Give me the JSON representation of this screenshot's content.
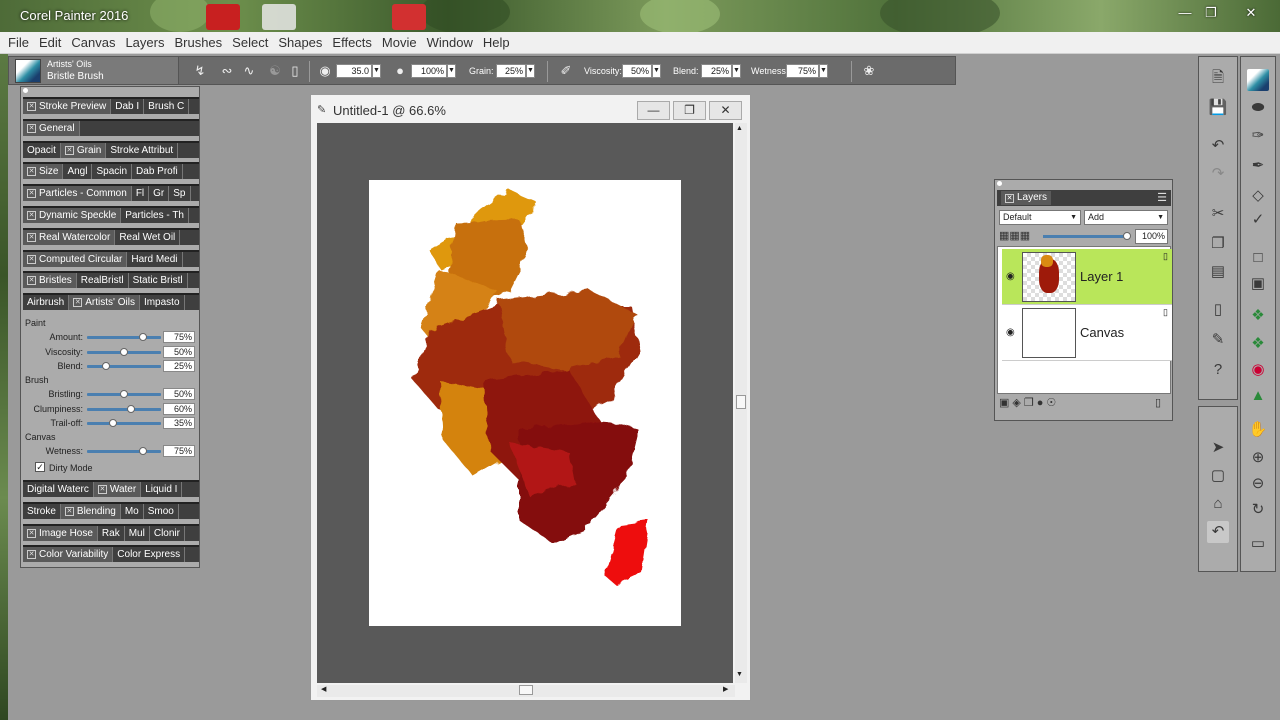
{
  "window": {
    "title": "Corel Painter 2016"
  },
  "menu": [
    "File",
    "Edit",
    "Canvas",
    "Layers",
    "Brushes",
    "Select",
    "Shapes",
    "Effects",
    "Movie",
    "Window",
    "Help"
  ],
  "property_bar": {
    "brush_category": "Artists' Oils",
    "brush_variant": "Bristle Brush",
    "size_value": "35.0",
    "opacity_value": "100%",
    "grain_label": "Grain:",
    "grain_value": "25%",
    "viscosity_label": "Viscosity:",
    "viscosity_value": "50%",
    "blend_label": "Blend:",
    "blend_value": "25%",
    "wetness_label": "Wetness:",
    "wetness_value": "75%"
  },
  "left_panel": {
    "tab_rows": [
      [
        "Stroke Preview",
        "Dab I",
        "Brush C"
      ],
      [
        "General"
      ],
      [
        "Opacit",
        "Grain",
        "Stroke Attribut"
      ],
      [
        "Size",
        "Angl",
        "Spacin",
        "Dab Profi"
      ],
      [
        "Particles - Common",
        "Fl",
        "Gr",
        "Sp"
      ],
      [
        "Dynamic Speckle",
        "Particles - Th"
      ],
      [
        "Real Watercolor",
        "Real Wet Oil"
      ],
      [
        "Computed Circular",
        "Hard Medi"
      ],
      [
        "Bristles",
        "RealBristl",
        "Static Bristl"
      ],
      [
        "Airbrush",
        "Artists' Oils",
        "Impasto"
      ]
    ],
    "tab_rows_bottom": [
      [
        "Digital Waterc",
        "Water",
        "Liquid I"
      ],
      [
        "Stroke",
        "Blending",
        "Mo",
        "Smoo"
      ],
      [
        "Image Hose",
        "Rak",
        "Mul",
        "Clonir"
      ],
      [
        "Color Variability",
        "Color Express"
      ]
    ],
    "artists_oils": {
      "paint_header": "Paint",
      "amount_label": "Amount:",
      "amount_value": "75%",
      "amount_pct": 75,
      "viscosity_label": "Viscosity:",
      "viscosity_value": "50%",
      "viscosity_pct": 50,
      "blend_label": "Blend:",
      "blend_value": "25%",
      "blend_pct": 25,
      "brush_header": "Brush",
      "bristling_label": "Bristling:",
      "bristling_value": "50%",
      "bristling_pct": 50,
      "clumpiness_label": "Clumpiness:",
      "clumpiness_value": "60%",
      "clumpiness_pct": 60,
      "trailoff_label": "Trail-off:",
      "trailoff_value": "35%",
      "trailoff_pct": 35,
      "canvas_header": "Canvas",
      "wetness_label": "Wetness:",
      "wetness_value": "75%",
      "wetness_pct": 75,
      "dirty_mode_label": "Dirty Mode",
      "dirty_mode_checked": true
    }
  },
  "document": {
    "title": "Untitled-1 @ 66.6%"
  },
  "layers": {
    "tab": "Layers",
    "composite_method": "Default",
    "composite_depth": "Add",
    "opacity_value": "100%",
    "items": [
      {
        "name": "Layer 1",
        "selected": true
      },
      {
        "name": "Canvas",
        "selected": false
      }
    ]
  },
  "colors": {
    "accent_selected_layer": "#b9e65a",
    "panel_bg": "#ababab",
    "canvas_bg": "#595959",
    "paint_orange": "#d98a12",
    "paint_red": "#9e1508",
    "paint_bright_red": "#ee0e0e"
  }
}
